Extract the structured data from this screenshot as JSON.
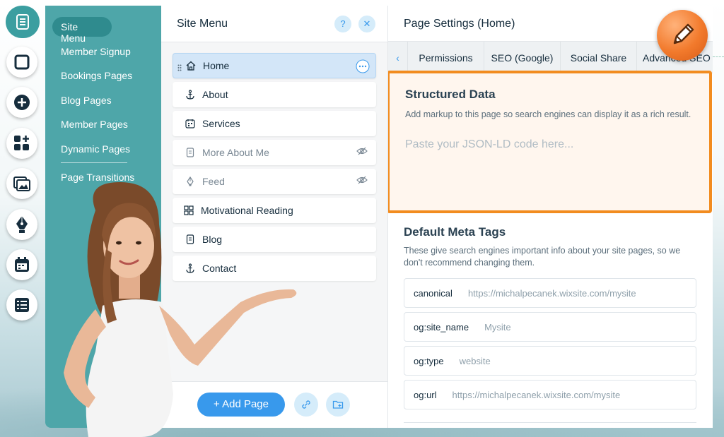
{
  "menu": {
    "active_label": "Site Menu",
    "items": [
      "Member Signup",
      "Bookings Pages",
      "Blog Pages",
      "Member Pages",
      "Dynamic Pages",
      "Page Transitions"
    ]
  },
  "site_panel": {
    "title": "Site Menu",
    "help_label": "?",
    "close_label": "✕",
    "pages": [
      {
        "label": "Home",
        "icon": "home-icon",
        "active": true,
        "hidden": false
      },
      {
        "label": "About",
        "icon": "anchor-icon",
        "active": false,
        "hidden": false
      },
      {
        "label": "Services",
        "icon": "calendar-icon",
        "active": false,
        "hidden": false
      },
      {
        "label": "More About Me",
        "icon": "page-icon",
        "active": false,
        "hidden": true
      },
      {
        "label": "Feed",
        "icon": "pen-icon",
        "active": false,
        "hidden": true
      },
      {
        "label": "Motivational Reading",
        "icon": "grid-icon",
        "active": false,
        "hidden": false
      },
      {
        "label": "Blog",
        "icon": "page-icon",
        "active": false,
        "hidden": false
      },
      {
        "label": "Contact",
        "icon": "anchor-icon",
        "active": false,
        "hidden": false
      }
    ],
    "add_page_label": "+ Add Page"
  },
  "settings": {
    "title": "Page Settings (Home)",
    "back_arrow": "‹",
    "tabs": [
      "Permissions",
      "SEO (Google)",
      "Social Share",
      "Advanced SEO"
    ],
    "structured_data": {
      "title": "Structured Data",
      "description": "Add markup to this page so search engines can display it as a rich result.",
      "placeholder": "Paste your JSON-LD code here..."
    },
    "meta_tags": {
      "title": "Default Meta Tags",
      "description": "These give search engines important info about your site pages, so we don't recommend changing them.",
      "rows": [
        {
          "key": "canonical",
          "value": "https://michalpecanek.wixsite.com/mysite"
        },
        {
          "key": "og:site_name",
          "value": "Mysite"
        },
        {
          "key": "og:type",
          "value": "website"
        },
        {
          "key": "og:url",
          "value": "https://michalpecanek.wixsite.com/mysite"
        }
      ]
    }
  },
  "colors": {
    "menu_teal": "#4ea6a9",
    "accent_blue": "#3899ec",
    "highlight_orange": "#f28c1f"
  }
}
